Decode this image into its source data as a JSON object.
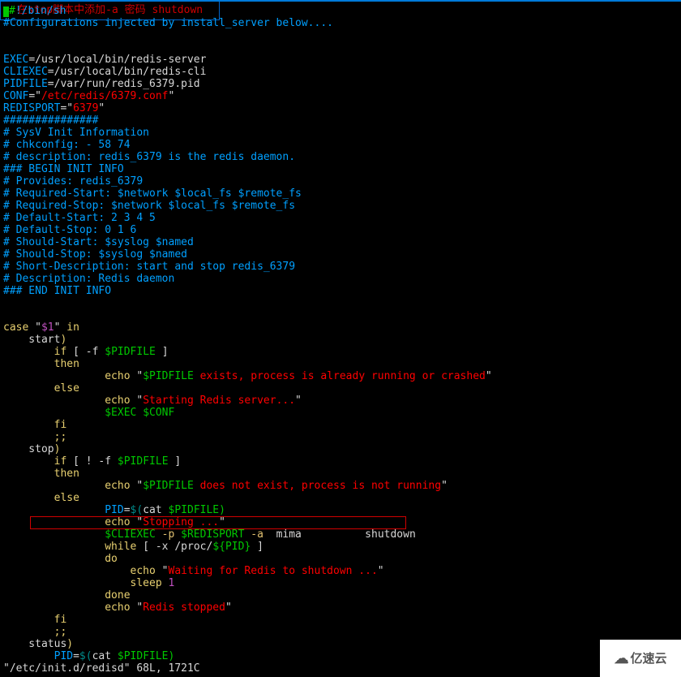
{
  "code": {
    "l1a": "#",
    "l1b": "!/bin/sh",
    "l2": "#Configurations injected by install_server below....",
    "l3_kw": "EXEC",
    "l3_eq": "=",
    "l3_val": "/usr/local/bin/redis-server",
    "l4_kw": "CLIEXEC",
    "l4_eq": "=",
    "l4_val": "/usr/local/bin/redis-cli",
    "l5_kw": "PIDFILE",
    "l5_eq": "=",
    "l5_val": "/var/run/redis_6379.pid",
    "l6_kw": "CONF",
    "l6_eq": "=\"",
    "l6_val": "/etc/redis/6379.conf",
    "l6_q": "\"",
    "l7_kw": "REDISPORT",
    "l7_eq": "=\"",
    "l7_val": "6379",
    "l7_q": "\"",
    "l8": "###############",
    "l9": "# SysV Init Information",
    "l10": "# chkconfig: - 58 74",
    "l11": "# description: redis_6379 is the redis daemon.",
    "l12": "### BEGIN INIT INFO",
    "l13": "# Provides: redis_6379",
    "l14": "# Required-Start: $network $local_fs $remote_fs",
    "l15": "# Required-Stop: $network $local_fs $remote_fs",
    "l16": "# Default-Start: 2 3 4 5",
    "l17": "# Default-Stop: 0 1 6",
    "l18": "# Should-Start: $syslog $named",
    "l19": "# Should-Stop: $syslog $named",
    "l20": "# Short-Description: start and stop redis_6379",
    "l21": "# Description: Redis daemon",
    "l22": "### END INIT INFO",
    "case_kw": "case",
    "case_q": " \"",
    "case_var": "$1",
    "case_q2": "\" ",
    "case_in": "in",
    "start_lbl": "    start",
    "start_paren": ")",
    "if1_kw": "        if",
    "if1_br": " [ -f ",
    "if1_var": "$PIDFILE",
    "if1_br2": " ]",
    "then1": "        then",
    "echo1_e": "                echo",
    "echo1_q": " \"",
    "echo1_v": "$PIDFILE",
    "echo1_s": " exists, process is already running or crashed",
    "echo1_q2": "\"",
    "else1": "        else",
    "echo2_e": "                echo",
    "echo2_q": " \"",
    "echo2_s": "Starting Redis server...",
    "echo2_q2": "\"",
    "exec_v": "                $EXEC",
    "exec_c": " $CONF",
    "fi1": "        fi",
    "semi1": "        ;;",
    "stop_lbl": "    stop",
    "stop_paren": ")",
    "if2_kw": "        if",
    "if2_br": " [ ! -f ",
    "if2_var": "$PIDFILE",
    "if2_br2": " ]",
    "then2": "        then",
    "echo3_e": "                echo",
    "echo3_q": " \"",
    "echo3_v": "$PIDFILE",
    "echo3_s": " does not exist, process is not running",
    "echo3_q2": "\"",
    "else2": "        else",
    "pid_kw": "                PID",
    "pid_eq": "=",
    "pid_dl": "$(",
    "pid_cat": "cat ",
    "pid_var": "$PIDFILE)",
    "echo4_e": "                echo",
    "echo4_q": " \"",
    "echo4_s": "Stopping ...",
    "echo4_q2": "\"",
    "cli_v": "                $CLIEXEC",
    "cli_p": " -p ",
    "cli_port": "$REDISPORT",
    "cli_a": " -a  ",
    "cli_mima": "mima",
    "cli_sp": "          ",
    "cli_sd": "shutdown",
    "while_kw": "                while",
    "while_br": " [ -x ",
    "while_path": "/proc/",
    "while_pid": "${PID}",
    "while_br2": " ]",
    "do": "                do",
    "echo5_e": "                    echo",
    "echo5_q": " \"",
    "echo5_s": "Waiting for Redis to shutdown ...",
    "echo5_q2": "\"",
    "sleep_kw": "                    sleep ",
    "sleep_n": "1",
    "done": "                done",
    "echo6_e": "                echo",
    "echo6_q": " \"",
    "echo6_s": "Redis stopped",
    "echo6_q2": "\"",
    "fi2": "        fi",
    "semi2": "        ;;",
    "status_lbl": "    status",
    "status_paren": ")",
    "pid2_kw": "        PID",
    "pid2_eq": "=",
    "pid2_dl": "$(",
    "pid2_cat": "cat ",
    "pid2_var": "$PIDFILE)",
    "statusline": "\"/etc/init.d/redisd\" 68L, 1721C"
  },
  "annotation": "在stop脚本中添加-a 密码 shutdown",
  "watermark": "亿速云"
}
